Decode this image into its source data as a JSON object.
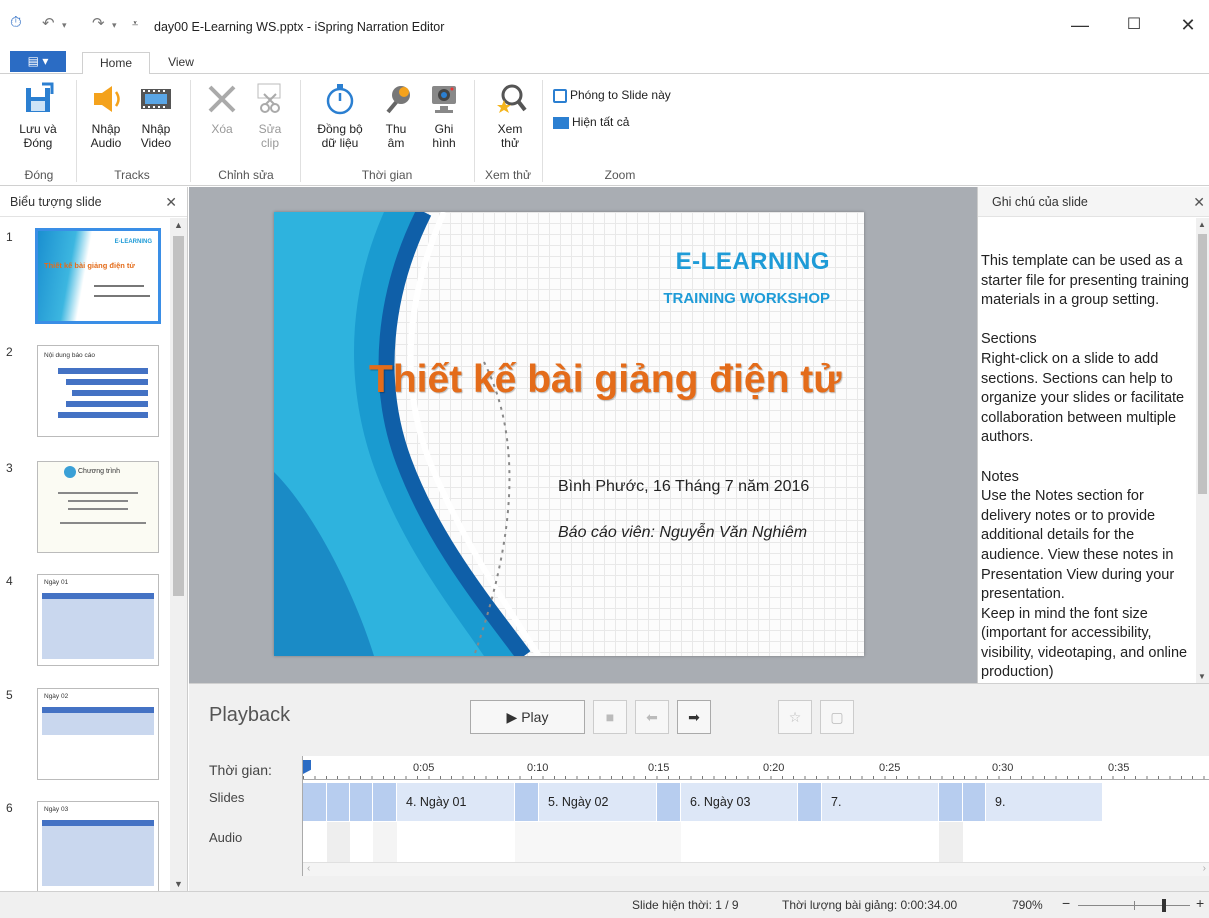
{
  "window": {
    "title": "day00 E-Learning WS.pptx - iSpring Narration Editor",
    "minimize": "—",
    "maximize": "☐",
    "close": "✕"
  },
  "tabs": {
    "file": "▤ ▾",
    "home": "Home",
    "view": "View"
  },
  "ribbon": {
    "save_close": "Lưu và\nĐóng",
    "import_audio": "Nhập\nAudio",
    "import_video": "Nhập\nVideo",
    "delete": "Xóa",
    "edit_clip": "Sửa\nclip",
    "sync": "Đồng bộ\ndữ liệu",
    "record_audio": "Thu\nâm",
    "record_video": "Ghi\nhình",
    "preview": "Xem\nthử",
    "zoom_slide": "Phóng to Slide này",
    "show_all": "Hiện tất cả",
    "groups": {
      "close": "Đóng",
      "tracks": "Tracks",
      "edit": "Chỉnh sửa",
      "time": "Thời gian",
      "preview": "Xem thử",
      "zoom": "Zoom"
    }
  },
  "left_panel": {
    "title": "Biểu tượng slide",
    "close": "✕",
    "thumbnails": [
      {
        "num": "1",
        "title": "Thiết kế bài giảng điện tử",
        "header": "E-LEARNING"
      },
      {
        "num": "2",
        "title": "Nội dung báo cáo"
      },
      {
        "num": "3",
        "title": "Chương trình"
      },
      {
        "num": "4",
        "title": "Ngày 01"
      },
      {
        "num": "5",
        "title": "Ngày 02"
      },
      {
        "num": "6",
        "title": "Ngày 03"
      }
    ]
  },
  "slide": {
    "header1": "E-LEARNING",
    "header2": "TRAINING WORKSHOP",
    "title": "Thiết kế bài giảng điện tử",
    "date": "Bình Phước, 16 Tháng 7 năm 2016",
    "presenter": "Báo cáo viên: Nguyễn Văn Nghiêm"
  },
  "notes_panel": {
    "title": "Ghi chú của slide",
    "close": "✕",
    "text": "This template can be used as a starter file for presenting training materials in a group setting.\n\nSections\nRight-click on a slide to add sections. Sections can help to organize your slides or facilitate collaboration between multiple authors.\n\nNotes\nUse the Notes section for delivery notes or to provide additional details for the audience. View these notes in Presentation View during your presentation.\nKeep in mind the font size (important for accessibility, visibility, videotaping, and online production)"
  },
  "playback": {
    "title": "Playback",
    "play": "▶ Play",
    "time_label": "Thời gian:",
    "slides_label": "Slides",
    "audio_label": "Audio",
    "ticks": [
      "0:05",
      "0:10",
      "0:15",
      "0:20",
      "0:25",
      "0:30",
      "0:35"
    ],
    "segments": [
      {
        "label": "4. Ngày 01"
      },
      {
        "label": "5. Ngày 02"
      },
      {
        "label": "6. Ngày 03"
      },
      {
        "label": "7."
      },
      {
        "label": "9."
      }
    ]
  },
  "status": {
    "current_slide": "Slide hiện thời: 1 / 9",
    "duration": "Thời lượng bài giảng: 0:00:34.00",
    "zoom": "790%"
  },
  "colors": {
    "accent": "#2b6cc4",
    "slide_title": "#e46c1a",
    "slide_header": "#1e9bd7",
    "segment": "#dde7f7",
    "segment_dark": "#b7cdef"
  }
}
